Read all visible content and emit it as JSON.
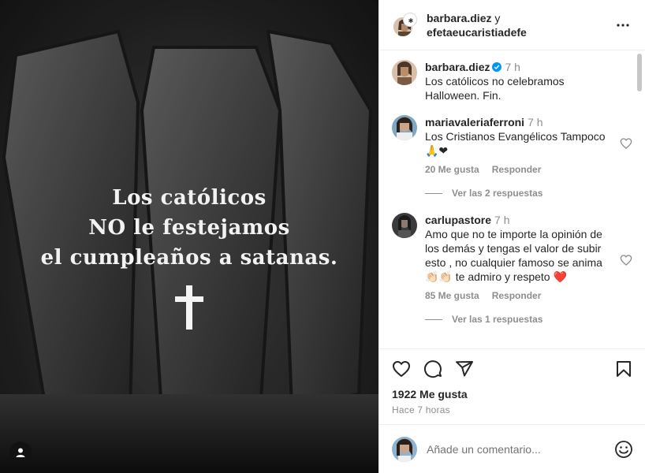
{
  "post_image": {
    "overlay_lines": [
      "Los católicos",
      "NO le festejamos",
      "el cumpleaños a satanas."
    ],
    "user_tag_icon": "user-icon"
  },
  "header": {
    "user1": "barbara.diez",
    "conj": " y",
    "user2": "efetaeucaristiadefe",
    "more_icon": "more-horizontal-icon"
  },
  "caption": {
    "username": "barbara.diez",
    "verified_icon": "verified-badge-icon",
    "time": "7 h",
    "text": "Los católicos no celebramos Halloween. Fin."
  },
  "comments": [
    {
      "username": "mariavaleriaferroni",
      "time": "7 h",
      "text": "Los Cristianos Evangélicos Tampoco 🙏❤",
      "likes": "20 Me gusta",
      "reply": "Responder",
      "view_replies": "Ver las 2 respuestas"
    },
    {
      "username": "carlupastore",
      "time": "7 h",
      "text": "Amo que no te importe la opinión de los demás y tengas el valor de subir esto , no cualquier famoso se anima 👏🏻👏🏻 te admiro y respeto ❤️",
      "likes": "85 Me gusta",
      "reply": "Responder",
      "view_replies": "Ver las 1 respuestas"
    }
  ],
  "actions": {
    "like_icon": "heart-icon",
    "comment_icon": "comment-icon",
    "share_icon": "share-icon",
    "save_icon": "bookmark-icon",
    "likes_count": "1922 Me gusta",
    "posted_ago": "Hace 7 horas"
  },
  "add_comment": {
    "placeholder": "Añade un comentario...",
    "emoji_icon": "emoji-icon"
  },
  "colors": {
    "accent_blue": "#0095f6",
    "muted": "#8e8e8e",
    "heart_red": "#ed4956"
  }
}
